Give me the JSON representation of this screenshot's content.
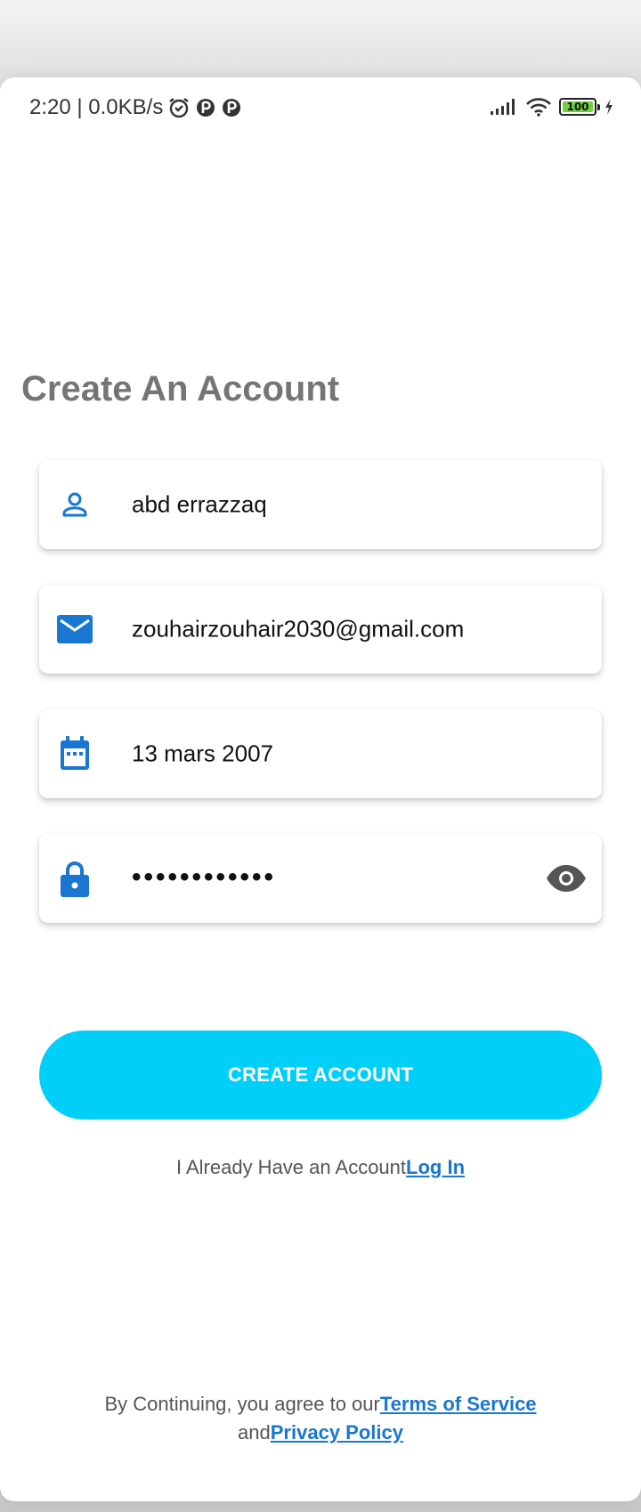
{
  "status_bar": {
    "time_speed": "2:20 | 0.0KB/s",
    "battery_level": "100",
    "icons": [
      "alarm-icon",
      "app-notification-icon",
      "app-notification-icon",
      "signal-icon",
      "wifi-icon",
      "battery-icon",
      "charging-icon"
    ]
  },
  "title": "Create An Account",
  "fields": {
    "name": {
      "value": "abd errazzaq",
      "icon": "person-icon"
    },
    "email": {
      "value": "zouhairzouhair2030@gmail.com",
      "icon": "mail-icon"
    },
    "birthdate": {
      "value": "13 mars 2007",
      "icon": "calendar-icon"
    },
    "password": {
      "value": "••••••••••••",
      "icon": "lock-icon",
      "toggle_icon": "eye-icon"
    }
  },
  "create_button_label": "CREATE ACCOUNT",
  "login_prompt": {
    "text": "I Already Have an Account",
    "link": "Log In"
  },
  "terms": {
    "prefix": "By Continuing, you agree to our",
    "terms_link": "Terms of Service",
    "and_text": "and",
    "privacy_link": "Privacy Policy"
  },
  "colors": {
    "accent_blue": "#1976d2",
    "button_cyan": "#00cffa",
    "title_gray": "#757575"
  }
}
